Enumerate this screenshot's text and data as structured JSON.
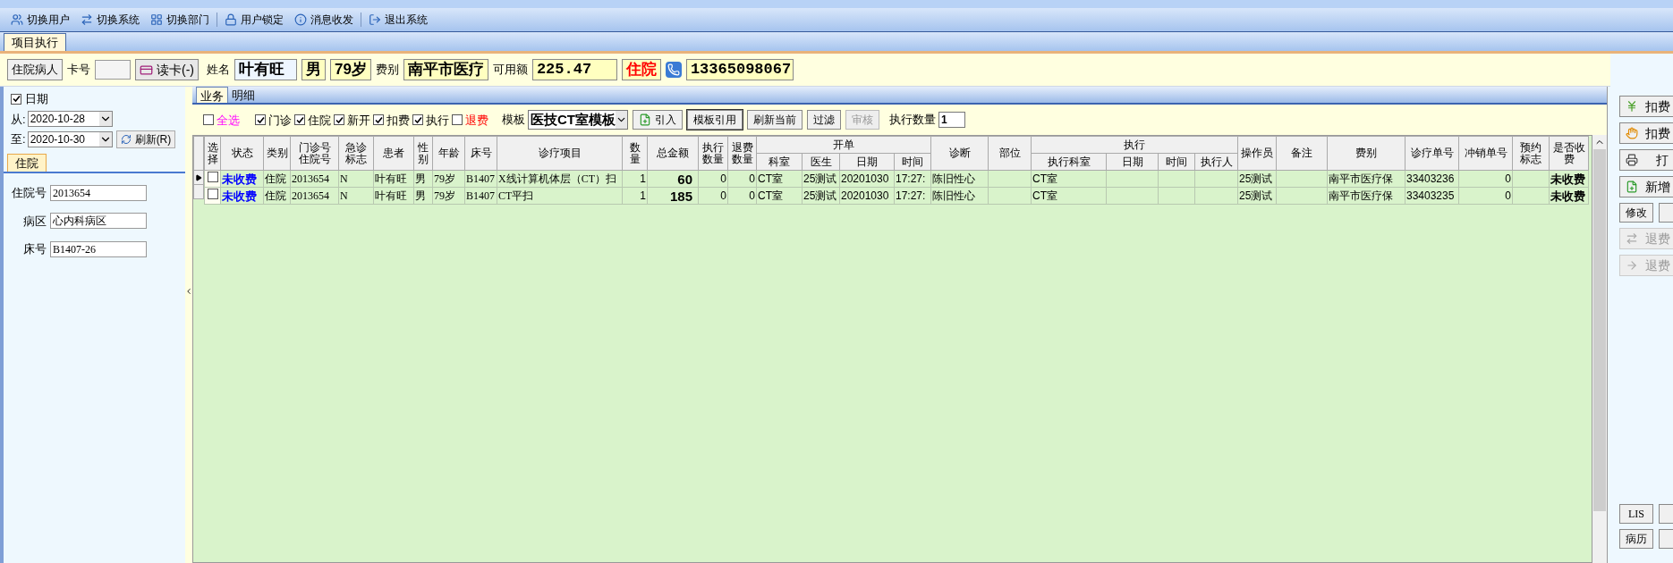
{
  "toolbar": [
    {
      "label": "切换用户"
    },
    {
      "label": "切换系统"
    },
    {
      "label": "切换部门"
    },
    {
      "label": "用户锁定"
    },
    {
      "label": "消息收发"
    },
    {
      "label": "退出系统"
    }
  ],
  "main_tab": {
    "label": "项目执行",
    "selected": true
  },
  "patient_bar": {
    "patient_type_button": "住院病人",
    "card_label": "卡号",
    "read_card_button": "读卡(-)",
    "name_label": "姓名",
    "name": "叶有旺",
    "sex": "男",
    "age": "79岁",
    "fee_type_label": "费别",
    "fee_type": "南平市医疗",
    "balance_label": "可用额",
    "balance": "225.47",
    "status": "住院",
    "phone": "13365098067"
  },
  "left_panel": {
    "date_filter": {
      "label": "日期",
      "checked": true
    },
    "from_label": "从:",
    "from_date": "2020-10-28",
    "to_label": "至:",
    "to_date": "2020-10-30",
    "refresh_button": "刷新(R)",
    "tab": {
      "label": "住院",
      "selected": true
    },
    "fields": [
      {
        "label": "住院号",
        "value": "2013654"
      },
      {
        "label": "病区",
        "value": "心内科病区"
      },
      {
        "label": "床号",
        "value": "B1407-26"
      }
    ]
  },
  "subtabs": [
    {
      "label": "业务",
      "selected": true
    },
    {
      "label": "明细",
      "selected": false
    }
  ],
  "filters": [
    {
      "label": "全选",
      "checked": false,
      "kind": "select-all"
    },
    {
      "label": "门诊",
      "checked": true,
      "kind": "filter"
    },
    {
      "label": "住院",
      "checked": true,
      "kind": "filter"
    },
    {
      "label": "新开",
      "checked": true,
      "kind": "filter"
    },
    {
      "label": "扣费",
      "checked": true,
      "kind": "filter"
    },
    {
      "label": "执行",
      "checked": true,
      "kind": "filter"
    },
    {
      "label": "退费",
      "checked": false,
      "kind": "refund"
    }
  ],
  "template": {
    "label": "模板",
    "value": "医技CT室模板"
  },
  "actions": [
    {
      "label": "引入",
      "disabled": false,
      "focused": false
    },
    {
      "label": "模板引用",
      "disabled": false,
      "focused": true
    },
    {
      "label": "刷新当前",
      "disabled": false,
      "focused": false
    },
    {
      "label": "过滤",
      "disabled": false,
      "focused": false
    },
    {
      "label": "审核",
      "disabled": true,
      "focused": false
    }
  ],
  "exec_count": {
    "label": "执行数量",
    "value": "1"
  },
  "table": {
    "columns": [
      {
        "label": "选择"
      },
      {
        "label": "状态"
      },
      {
        "label": "类别"
      },
      {
        "label": "门诊号住院号"
      },
      {
        "label": "急诊标志"
      },
      {
        "label": "患者"
      },
      {
        "label": "性别"
      },
      {
        "label": "年龄"
      },
      {
        "label": "床号"
      },
      {
        "label": "诊疗项目"
      },
      {
        "label": "数量"
      },
      {
        "label": "总金额"
      },
      {
        "label": "执行数量"
      },
      {
        "label": "退费数量"
      },
      {
        "label": "开单",
        "colspan": 4,
        "children": [
          {
            "label": "科室"
          },
          {
            "label": "医生"
          },
          {
            "label": "日期"
          },
          {
            "label": "时间"
          }
        ]
      },
      {
        "label": "诊断"
      },
      {
        "label": "部位"
      },
      {
        "label": "执行",
        "colspan": 4,
        "children": [
          {
            "label": "执行科室"
          },
          {
            "label": "日期"
          },
          {
            "label": "时间"
          },
          {
            "label": "执行人"
          }
        ]
      },
      {
        "label": "操作员"
      },
      {
        "label": "备注"
      },
      {
        "label": "费别"
      },
      {
        "label": "诊疗单号"
      },
      {
        "label": "冲销单号"
      },
      {
        "label": "预约标志"
      },
      {
        "label": "是否收费"
      }
    ],
    "rows": [
      {
        "current": true,
        "checked": false,
        "cells": [
          "",
          "未收费",
          "住院",
          "2013654",
          "N",
          "叶有旺",
          "男",
          "79岁",
          "B1407",
          "X线计算机体层（CT）扫",
          "1",
          "60",
          "0",
          "0",
          "CT室",
          "25测试",
          "20201030",
          "17:27:",
          "陈旧性心",
          "",
          "CT室",
          "",
          "",
          "",
          "25测试",
          "",
          "南平市医疗保",
          "33403236",
          "0",
          "",
          "未收费"
        ]
      },
      {
        "current": false,
        "checked": false,
        "cells": [
          "",
          "未收费",
          "住院",
          "2013654",
          "N",
          "叶有旺",
          "男",
          "79岁",
          "B1407",
          "CT平扫",
          "1",
          "185",
          "0",
          "0",
          "CT室",
          "25测试",
          "20201030",
          "17:27:",
          "陈旧性心",
          "",
          "CT室",
          "",
          "",
          "",
          "25测试",
          "",
          "南平市医疗保",
          "33403235",
          "0",
          "",
          "未收费"
        ]
      }
    ]
  },
  "right_buttons": [
    {
      "kind": "wide",
      "label": "扣费",
      "disabled": false
    },
    {
      "kind": "wide",
      "label": "扣费",
      "disabled": false
    },
    {
      "kind": "wide",
      "label": "打",
      "disabled": false
    },
    {
      "kind": "wide",
      "label": "新增",
      "disabled": false
    },
    {
      "kind": "pair",
      "items": [
        {
          "label": "修改"
        }
      ]
    },
    {
      "kind": "wide",
      "label": "退费",
      "disabled": true
    },
    {
      "kind": "wide",
      "label": "退费",
      "disabled": true
    },
    {
      "kind": "spacer"
    },
    {
      "kind": "pair",
      "items": [
        {
          "label": "LIS"
        }
      ]
    },
    {
      "kind": "pair",
      "items": [
        {
          "label": "病历"
        }
      ]
    }
  ]
}
